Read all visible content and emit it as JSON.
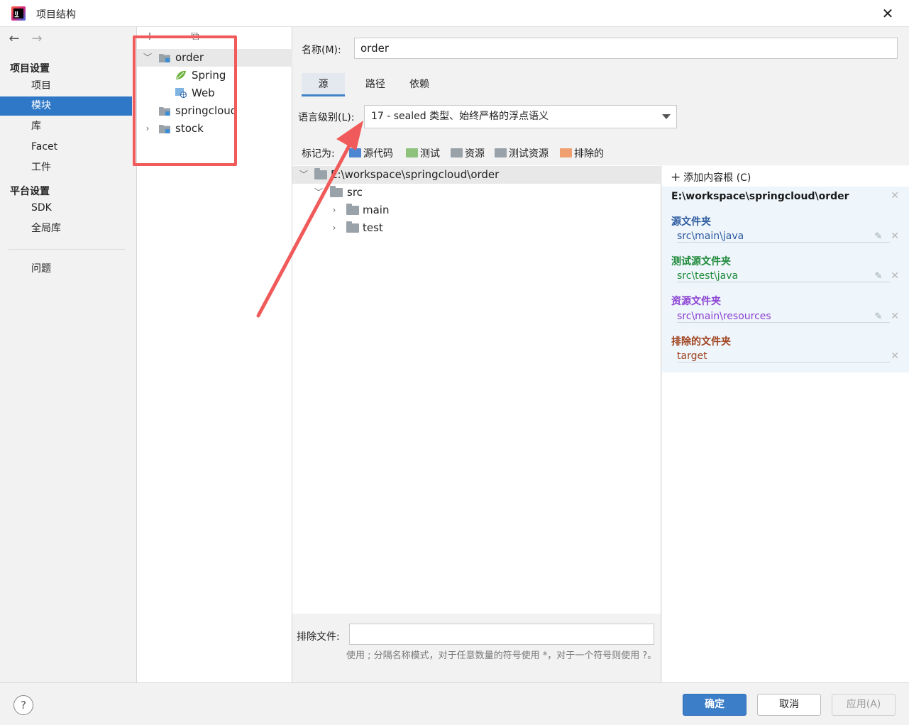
{
  "window": {
    "title": "项目结构",
    "close_glyph": "✕"
  },
  "nav": {
    "section_project": "项目设置",
    "items_project": [
      "项目",
      "模块",
      "库",
      "Facet",
      "工件"
    ],
    "section_platform": "平台设置",
    "items_platform": [
      "SDK",
      "全局库"
    ],
    "problems": "问题",
    "selected": "模块"
  },
  "modules": {
    "rows": [
      {
        "name": "order",
        "expanded": true,
        "selected": true
      },
      {
        "name": "Spring",
        "facet": "spring"
      },
      {
        "name": "Web",
        "facet": "web"
      },
      {
        "name": "springcloud"
      },
      {
        "name": "stock",
        "collapsed": true
      }
    ]
  },
  "content": {
    "name_label": "名称(M):",
    "name_value": "order",
    "tabs": [
      "源",
      "路径",
      "依赖"
    ],
    "active_tab": "源",
    "lang_label": "语言级别(L):",
    "lang_value": "17 - sealed 类型、始终严格的浮点语义",
    "mark_label": "标记为:",
    "mark_items": [
      "源代码",
      "测试",
      "资源",
      "测试资源",
      "排除的"
    ],
    "tree": [
      {
        "label": "E:\\workspace\\springcloud\\order",
        "level": 0
      },
      {
        "label": "src",
        "level": 1
      },
      {
        "label": "main",
        "level": 2
      },
      {
        "label": "test",
        "level": 2
      }
    ],
    "add_root": "添加内容根 (C)",
    "root_path": "E:\\workspace\\springcloud\\order",
    "groups": [
      {
        "title": "源文件夹",
        "path": "src\\main\\java",
        "color": "#2c5aa0"
      },
      {
        "title": "测试源文件夹",
        "path": "src\\test\\java",
        "color": "#1f8a3a"
      },
      {
        "title": "资源文件夹",
        "path": "src\\main\\resources",
        "color": "#8a3fd1"
      },
      {
        "title": "排除的文件夹",
        "path": "target",
        "color": "#a0421f"
      }
    ],
    "exclude_label": "排除文件:",
    "exclude_hint": "使用 ; 分隔名称模式，对于任意数量的符号使用 *，对于一个符号则使用 ?。"
  },
  "footer": {
    "help": "?",
    "ok": "确定",
    "cancel": "取消",
    "apply": "应用(A)"
  },
  "colors": {
    "selection": "#2f78c7",
    "annotation": "#f05a5a",
    "primary_button": "#3d7ec9"
  }
}
